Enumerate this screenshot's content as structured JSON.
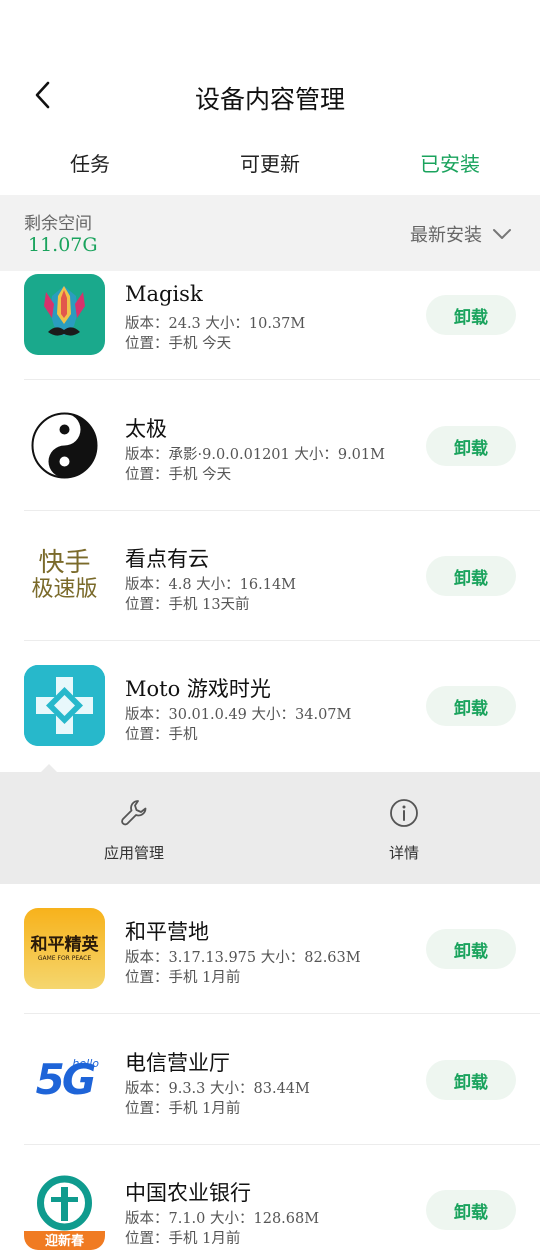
{
  "header": {
    "title": "设备内容管理"
  },
  "tabs": [
    {
      "label": "任务"
    },
    {
      "label": "可更新"
    },
    {
      "label": "已安装",
      "active": true
    }
  ],
  "storage": {
    "label": "剩余空间",
    "value": "11.07G",
    "sort_label": "最新安装"
  },
  "apps": [
    {
      "name": "Magisk",
      "meta1": "版本：24.3   大小：10.37M",
      "meta2": "位置：手机   今天",
      "button": "卸载",
      "icon": "magisk-icon"
    },
    {
      "name": "太极",
      "meta1": "版本：承影·9.0.0.01201   大小：9.01M",
      "meta2": "位置：手机   今天",
      "button": "卸载",
      "icon": "taichi-icon"
    },
    {
      "name": "看点有云",
      "meta1": "版本：4.8   大小：16.14M",
      "meta2": "位置：手机   13天前",
      "button": "卸载",
      "icon": "kuaishou-icon",
      "icon_text1": "快手",
      "icon_text2": "极速版"
    },
    {
      "name": "Moto 游戏时光",
      "meta1": "版本：30.01.0.49   大小：34.07M",
      "meta2": "位置：手机",
      "button": "卸载",
      "icon": "gamepad-icon"
    },
    {
      "name": "和平营地",
      "meta1": "版本：3.17.13.975   大小：82.63M",
      "meta2": "位置：手机   1月前",
      "button": "卸载",
      "icon": "peace-elite-icon",
      "icon_text1": "和平精英",
      "icon_text2": "GAME FOR PEACE"
    },
    {
      "name": "电信营业厅",
      "meta1": "版本：9.3.3   大小：83.44M",
      "meta2": "位置：手机   1月前",
      "button": "卸载",
      "icon": "telecom-5g-icon",
      "icon_text1": "5G",
      "icon_text2": "hello"
    },
    {
      "name": "中国农业银行",
      "meta1": "版本：7.1.0   大小：128.68M",
      "meta2": "位置：手机   1月前",
      "button": "卸载",
      "icon": "abc-bank-icon",
      "icon_text1": "迎新春"
    }
  ],
  "actions": [
    {
      "label": "应用管理",
      "icon": "wrench-icon"
    },
    {
      "label": "详情",
      "icon": "info-icon"
    }
  ],
  "colors": {
    "accent": "#1aa35d",
    "button_bg": "#eef6f0",
    "panel_bg": "#ebebeb",
    "storage_bg": "#f2f2f2"
  }
}
